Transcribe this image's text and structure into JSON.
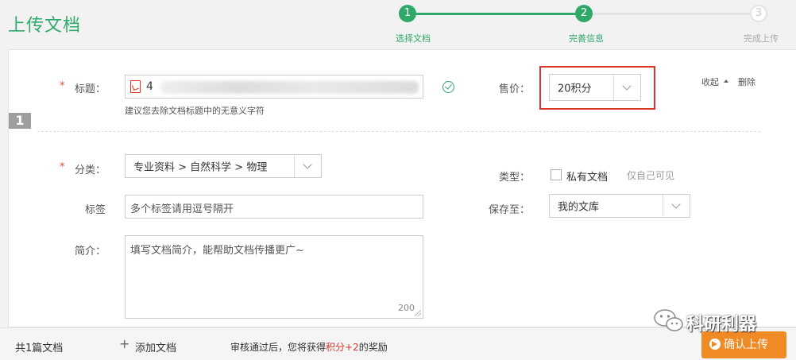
{
  "header": {
    "title": "上传文档",
    "steps": [
      {
        "number": "1",
        "label": "选择文档",
        "state": "done"
      },
      {
        "number": "2",
        "label": "完善信息",
        "state": "active"
      },
      {
        "number": "3",
        "label": "完成上传",
        "state": "pending"
      }
    ]
  },
  "form": {
    "index": "1",
    "title_field": {
      "label": "标题：",
      "required_mark": "*",
      "value_prefix": "4",
      "hint": "建议您去除文档标题中的无意义字符",
      "icon": "pdf-icon"
    },
    "price": {
      "label": "售价：",
      "value": "20积分"
    },
    "actions": {
      "collapse": "收起",
      "delete": "删除"
    },
    "category": {
      "label": "分类：",
      "required_mark": "*",
      "value": "专业资料 > 自然科学 > 物理"
    },
    "tags": {
      "label": "标签",
      "placeholder": "多个标签请用逗号隔开"
    },
    "summary": {
      "label": "简介：",
      "placeholder": "填写文档简介，能帮助文档传播更广~",
      "char_limit": "200"
    },
    "type": {
      "label": "类型：",
      "option": "私有文档",
      "note": "仅自己可见"
    },
    "save_to": {
      "label": "保存至：",
      "value": "我的文库"
    }
  },
  "footer": {
    "doc_count_prefix": "共",
    "doc_count_num": "1",
    "doc_count_suffix": "篇文档",
    "add_doc": "添加文档",
    "reward_prefix": "审核通过后，您将获得",
    "reward_points": "积分+2",
    "reward_suffix": "的奖励",
    "confirm": "确认上传"
  },
  "watermark": {
    "text": "科研利器"
  },
  "colors": {
    "brand_green": "#2fa86a",
    "highlight_red": "#d9352b",
    "confirm_orange": "#f08a24"
  }
}
